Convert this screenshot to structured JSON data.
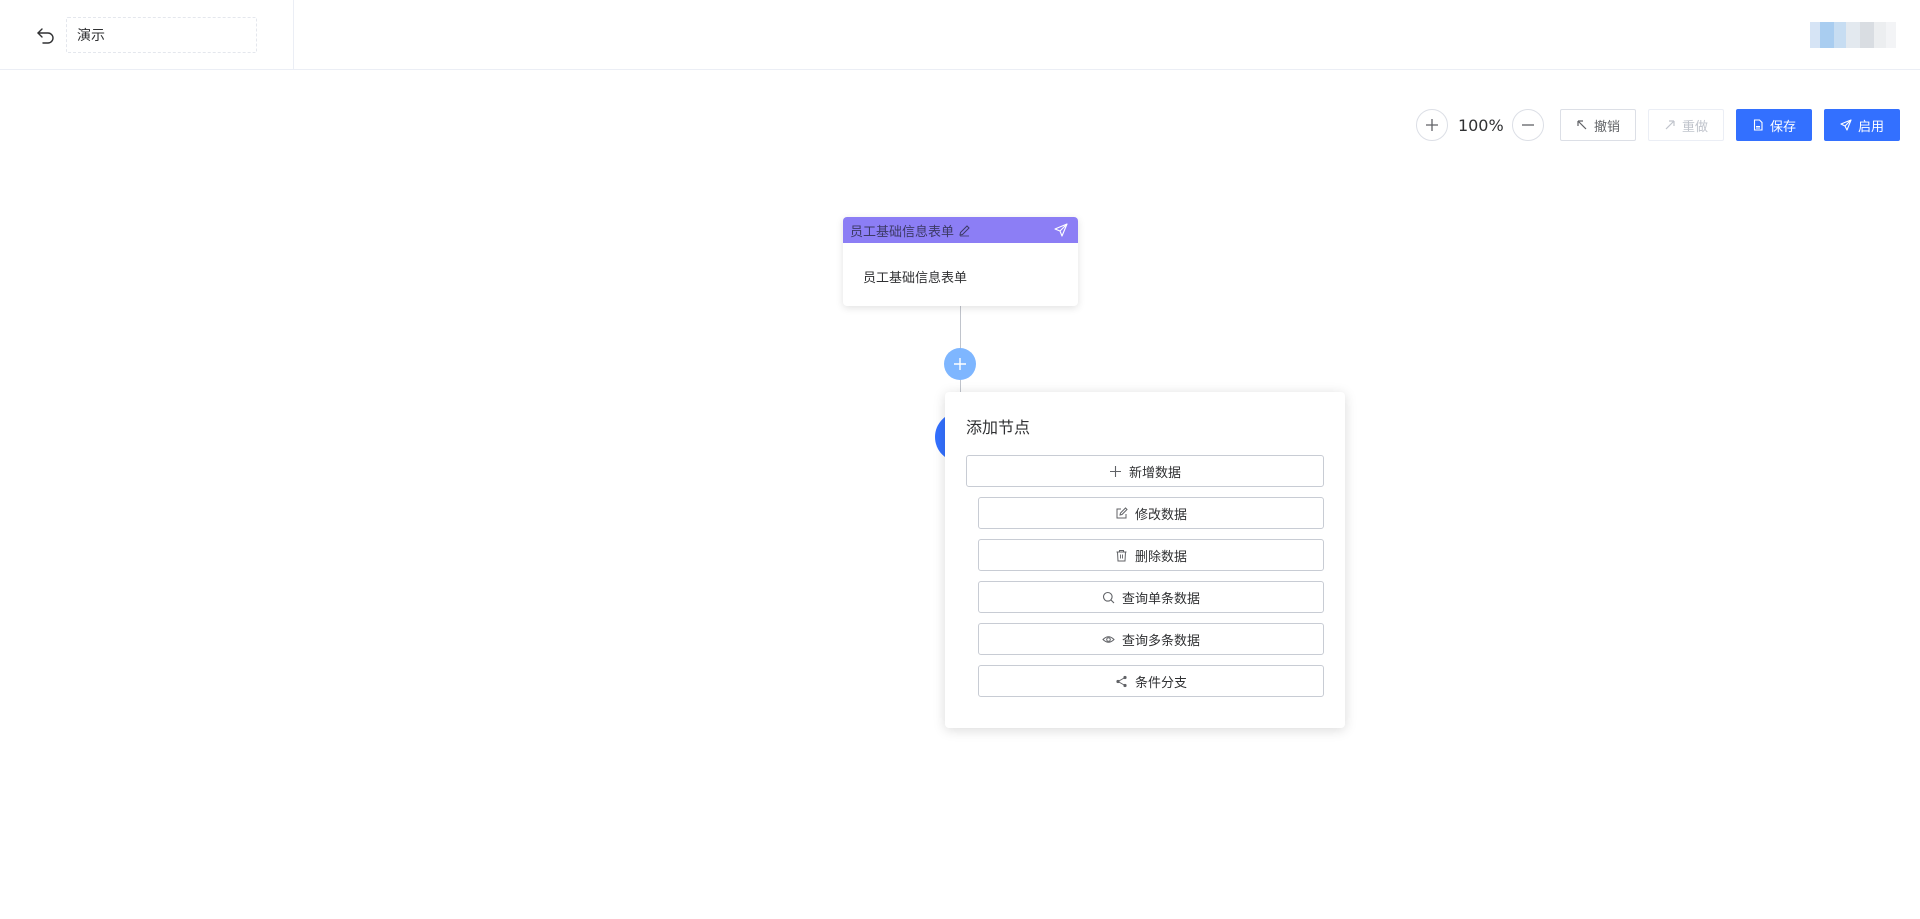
{
  "header": {
    "back_icon": "undo-arrow-icon",
    "title_value": "演示",
    "avatar_icon": "user-avatar-pixelated"
  },
  "toolbar": {
    "zoom_in_icon": "plus-icon",
    "zoom_level": "100%",
    "zoom_out_icon": "minus-icon",
    "undo_label": "撤销",
    "redo_label": "重做",
    "save_label": "保存",
    "enable_label": "启用"
  },
  "node": {
    "header_title": "员工基础信息表单",
    "body_text": "员工基础信息表单",
    "header_color": "#8c7ef5"
  },
  "popover": {
    "title": "添加节点",
    "items": [
      {
        "label": "新增数据",
        "icon": "plus-icon"
      },
      {
        "label": "修改数据",
        "icon": "edit-icon"
      },
      {
        "label": "删除数据",
        "icon": "trash-icon"
      },
      {
        "label": "查询单条数据",
        "icon": "search-icon"
      },
      {
        "label": "查询多条数据",
        "icon": "eye-icon"
      },
      {
        "label": "条件分支",
        "icon": "share-icon"
      }
    ]
  },
  "colors": {
    "primary": "#3370ff",
    "add_button": "#7eb6ff",
    "node_header": "#8c7ef5"
  }
}
